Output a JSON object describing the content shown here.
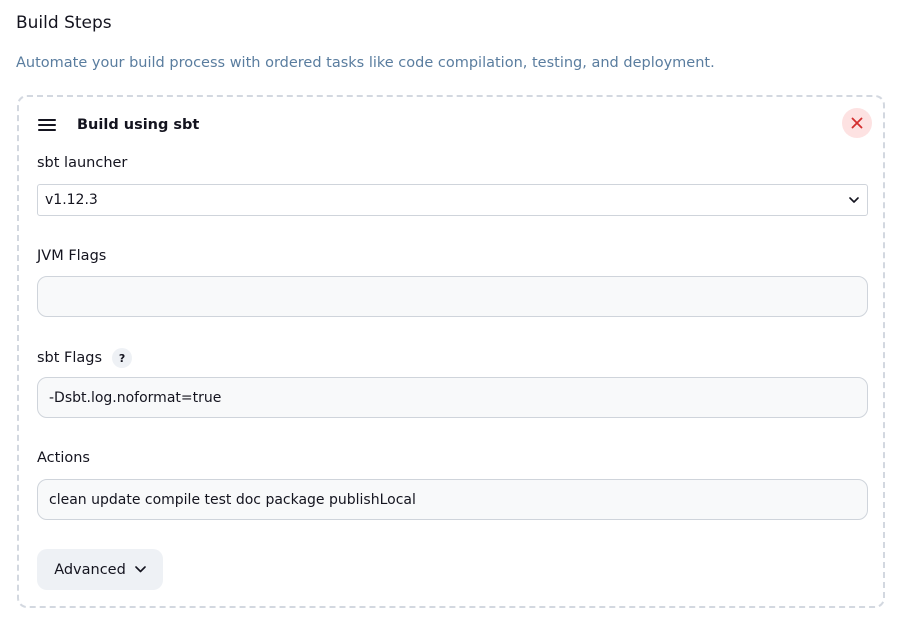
{
  "section": {
    "title": "Build Steps",
    "description": "Automate your build process with ordered tasks like code compilation, testing, and deployment."
  },
  "step": {
    "title": "Build using sbt",
    "fields": {
      "launcher": {
        "label": "sbt launcher",
        "value": "v1.12.3"
      },
      "jvm_flags": {
        "label": "JVM Flags",
        "value": ""
      },
      "sbt_flags": {
        "label": "sbt Flags",
        "help": "?",
        "value": "-Dsbt.log.noformat=true"
      },
      "actions": {
        "label": "Actions",
        "value": "clean update compile test doc package publishLocal"
      }
    },
    "advanced_label": "Advanced"
  },
  "icons": {
    "drag": "drag-handle-icon",
    "close": "close-icon",
    "select_chevron": "chevron-down-icon",
    "advanced_chevron": "chevron-down-icon"
  },
  "colors": {
    "description": "#5a7d9f",
    "close_bg": "#fde2e2",
    "close_fg": "#d32f2f",
    "dashed_border": "#d3d8e0"
  }
}
